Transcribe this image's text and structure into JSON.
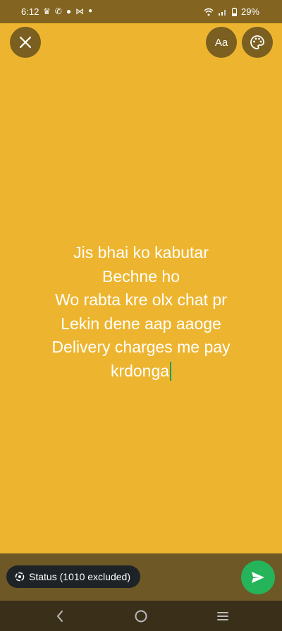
{
  "status_bar": {
    "time": "6:12",
    "battery": "29%",
    "notification_icons": [
      "snapchat-icon",
      "whatsapp-icon",
      "chat-bubble-icon",
      "capcut-icon",
      "dot-icon"
    ],
    "system_icons": [
      "wifi-icon",
      "signal-icon",
      "battery-icon"
    ]
  },
  "toolbar": {
    "font_button_label": "Aa",
    "close_icon": "close-icon",
    "palette_icon": "palette-icon"
  },
  "story": {
    "background_color": "#EDB52F",
    "text_color": "#FFFFFF",
    "lines": [
      "Jis bhai ko kabutar",
      "Bechne ho",
      "Wo rabta kre olx chat pr",
      "Lekin dene aap aaoge",
      "Delivery charges me pay",
      "krdonga"
    ]
  },
  "footer": {
    "audience_label": "Status (1010 excluded)",
    "send_color": "#25B459"
  },
  "nav": {
    "icons": [
      "back-icon",
      "home-icon",
      "recents-icon"
    ]
  }
}
